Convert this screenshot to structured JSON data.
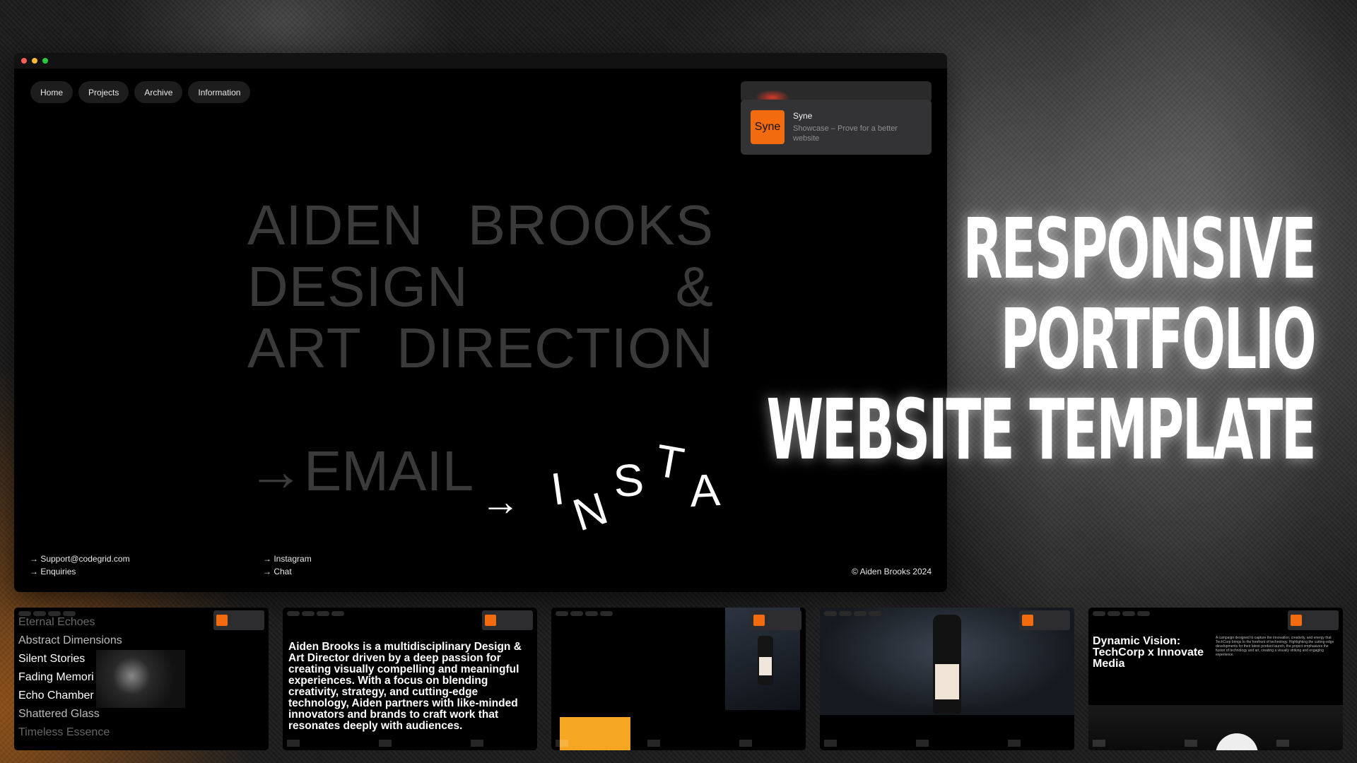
{
  "window": {
    "nav": [
      "Home",
      "Projects",
      "Archive",
      "Information"
    ],
    "notification": {
      "logo_text": "Syne",
      "title": "Syne",
      "subtitle": "Showcase – Prove for a better website"
    },
    "hero": {
      "line1": [
        "AIDEN",
        "BROOKS"
      ],
      "line2": [
        "DESIGN",
        "&"
      ],
      "line3": [
        "ART",
        "DIRECTION"
      ],
      "email": "→EMAIL",
      "insta_arrow": "→",
      "insta_letters": [
        "I",
        "N",
        "S",
        "T",
        "A"
      ]
    },
    "footer": {
      "col1": [
        "→ Support@codegrid.com",
        "→ Enquiries"
      ],
      "col2": [
        "→ Instagram",
        "→ Chat"
      ],
      "copyright": "© Aiden Brooks 2024"
    }
  },
  "headline": [
    "RESPONSIVE",
    "PORTFOLIO",
    "WEBSITE TEMPLATE"
  ],
  "thumbnails": {
    "projects_list": [
      "Eternal Echoes",
      "Abstract Dimensions",
      "Silent Stories",
      "Fading Memori",
      "Echo Chamber",
      "Shattered Glass",
      "Timeless Essence"
    ],
    "bio": "Aiden Brooks is a multidisciplinary Design & Art Director driven by a deep passion for creating visually compelling and meaningful experiences. With a focus on blending creativity, strategy, and cutting-edge technology, Aiden partners with like-minded innovators and brands to craft work that resonates deeply with audiences.",
    "case_title": "Dynamic Vision: TechCorp x Innovate Media",
    "case_desc": "A campaign designed to capture the innovation, creativity, and energy that TechCorp brings to the forefront of technology. Highlighting the cutting-edge developments for their latest product launch, the project emphasizes the fusion of technology and art, creating a visually striking and engaging experience.",
    "accent": "#f5a623"
  },
  "colors": {
    "syne_orange": "#f26b0f",
    "hero_gray": "#3a3a3a"
  }
}
